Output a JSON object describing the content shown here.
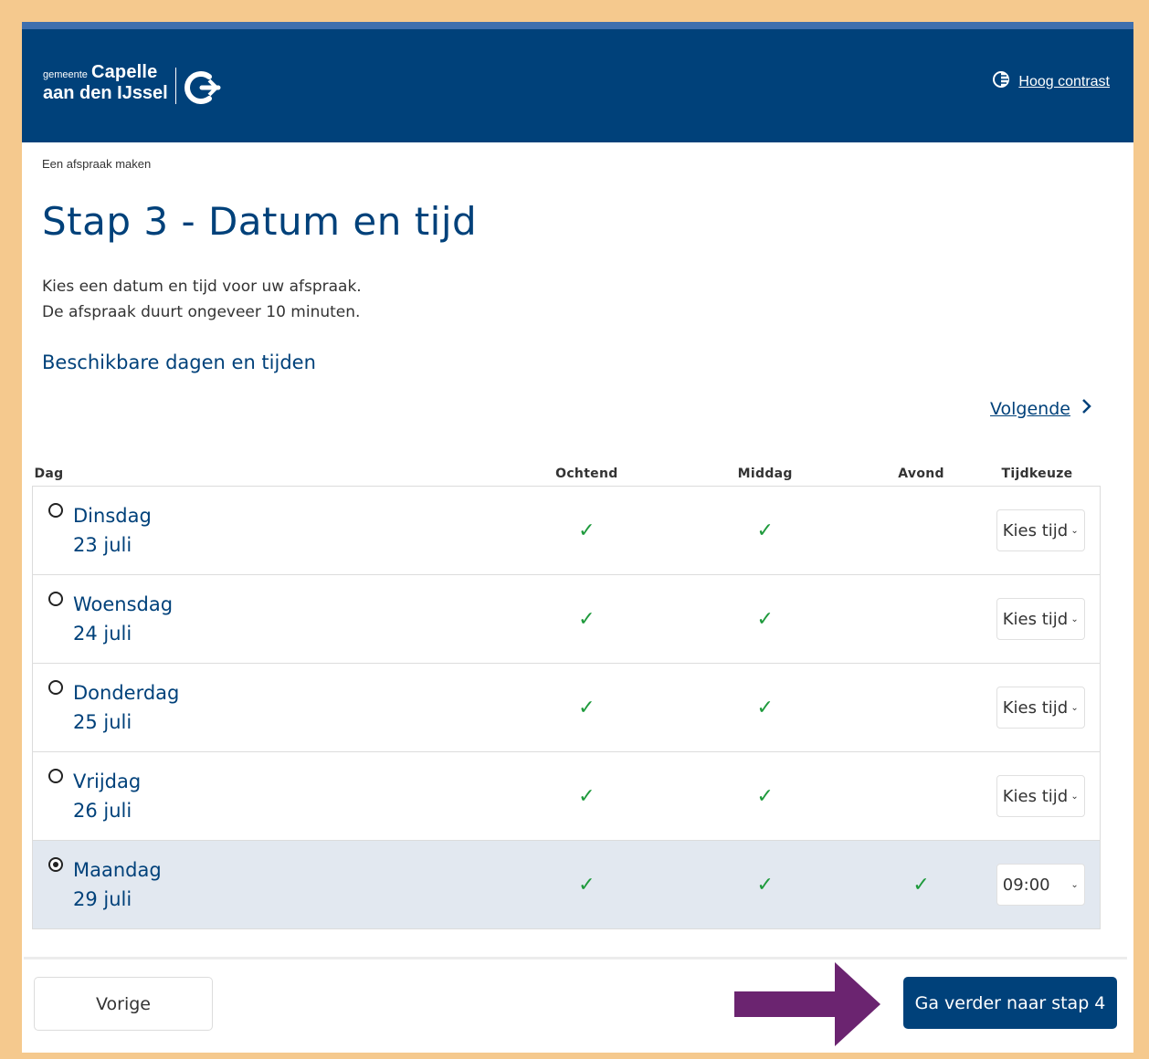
{
  "header": {
    "logo_small": "gemeente",
    "logo_big": "Capelle",
    "logo_line2": "aan den IJssel",
    "contrast_label": "Hoog contrast"
  },
  "breadcrumb": "Een afspraak maken",
  "page_title": "Stap 3 - Datum en tijd",
  "intro": {
    "line1": "Kies een datum en tijd voor uw afspraak.",
    "line2": "De afspraak duurt ongeveer 10 minuten."
  },
  "section_title": "Beschikbare dagen en tijden",
  "next_link": "Volgende",
  "table": {
    "headers": [
      "Dag",
      "Ochtend",
      "Middag",
      "Avond",
      "Tijdkeuze"
    ],
    "rows": [
      {
        "day": "Dinsdag",
        "date": "23 juli",
        "ochtend": "✓",
        "middag": "✓",
        "avond": "",
        "tijd": "Kies tijd",
        "selected": false
      },
      {
        "day": "Woensdag",
        "date": "24 juli",
        "ochtend": "✓",
        "middag": "✓",
        "avond": "",
        "tijd": "Kies tijd",
        "selected": false
      },
      {
        "day": "Donderdag",
        "date": "25 juli",
        "ochtend": "✓",
        "middag": "✓",
        "avond": "",
        "tijd": "Kies tijd",
        "selected": false
      },
      {
        "day": "Vrijdag",
        "date": "26 juli",
        "ochtend": "✓",
        "middag": "✓",
        "avond": "",
        "tijd": "Kies tijd",
        "selected": false
      },
      {
        "day": "Maandag",
        "date": "29 juli",
        "ochtend": "✓",
        "middag": "✓",
        "avond": "✓",
        "tijd": "09:00",
        "selected": true
      }
    ]
  },
  "buttons": {
    "prev": "Vorige",
    "next": "Ga verder naar stap 4"
  },
  "colors": {
    "brand": "#00417a",
    "check": "#1e9a3c",
    "arrow": "#6b2470",
    "frame": "#f5c98e"
  },
  "icons": {
    "contrast": "contrast-icon",
    "next": "chevron-right-icon",
    "select": "chevron-down-icon",
    "annotation": "arrow-right-icon"
  }
}
